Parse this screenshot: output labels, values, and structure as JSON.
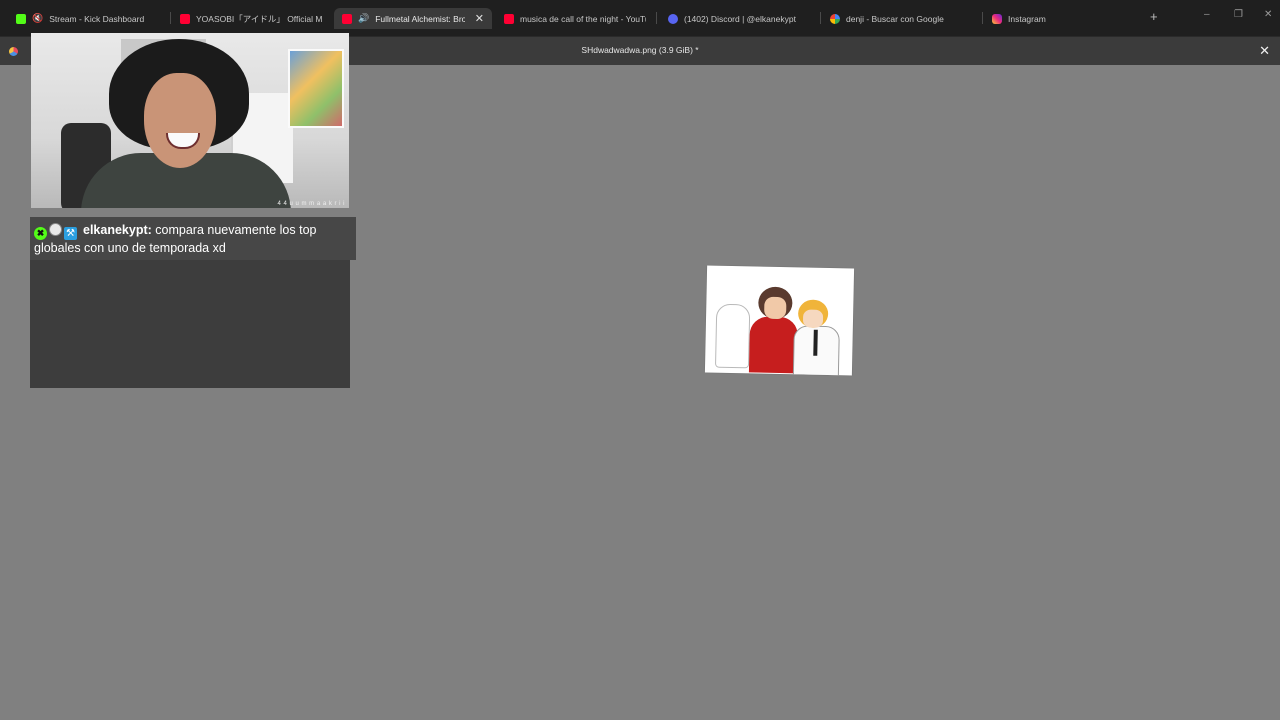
{
  "browser": {
    "tabs": [
      {
        "title": "Stream - Kick Dashboard",
        "icon": "kick-icon",
        "muted": true,
        "active": false
      },
      {
        "title": "YOASOBI「アイドル」 Official Music Vid",
        "icon": "youtube-icon",
        "active": false
      },
      {
        "title": "Fullmetal Alchemist: Brotherh",
        "icon": "youtube-icon",
        "audio": true,
        "active": true
      },
      {
        "title": "musica de call of the night - YouTub",
        "icon": "youtube-icon",
        "active": false
      },
      {
        "title": "(1402) Discord | @elkanekypt",
        "icon": "discord-icon",
        "active": false
      },
      {
        "title": "denji - Buscar con Google",
        "icon": "google-icon",
        "active": false
      },
      {
        "title": "Instagram",
        "icon": "instagram-icon",
        "active": false
      }
    ],
    "new_tab_glyph": "+",
    "window_controls": {
      "minimize": "–",
      "restore": "❐",
      "close": "✕"
    }
  },
  "viewer": {
    "title": "SHdwadwadwa.png (3.9 GiB) *",
    "close_glyph": "✕"
  },
  "webcam": {
    "watermark": "4 4 u u m m a a k r i i"
  },
  "chat": {
    "messages": [
      {
        "username": "elkanekypt:",
        "text": "compara nuevamente los top globales con uno de temporada xd",
        "badges": [
          "moderator",
          "og",
          "subscriber"
        ]
      }
    ]
  },
  "colors": {
    "canvas_bg": "#808080",
    "tabbar_bg": "#1f1f1f",
    "kick_green": "#53fc18",
    "youtube_red": "#ff0033",
    "discord_blurple": "#5865f2"
  }
}
